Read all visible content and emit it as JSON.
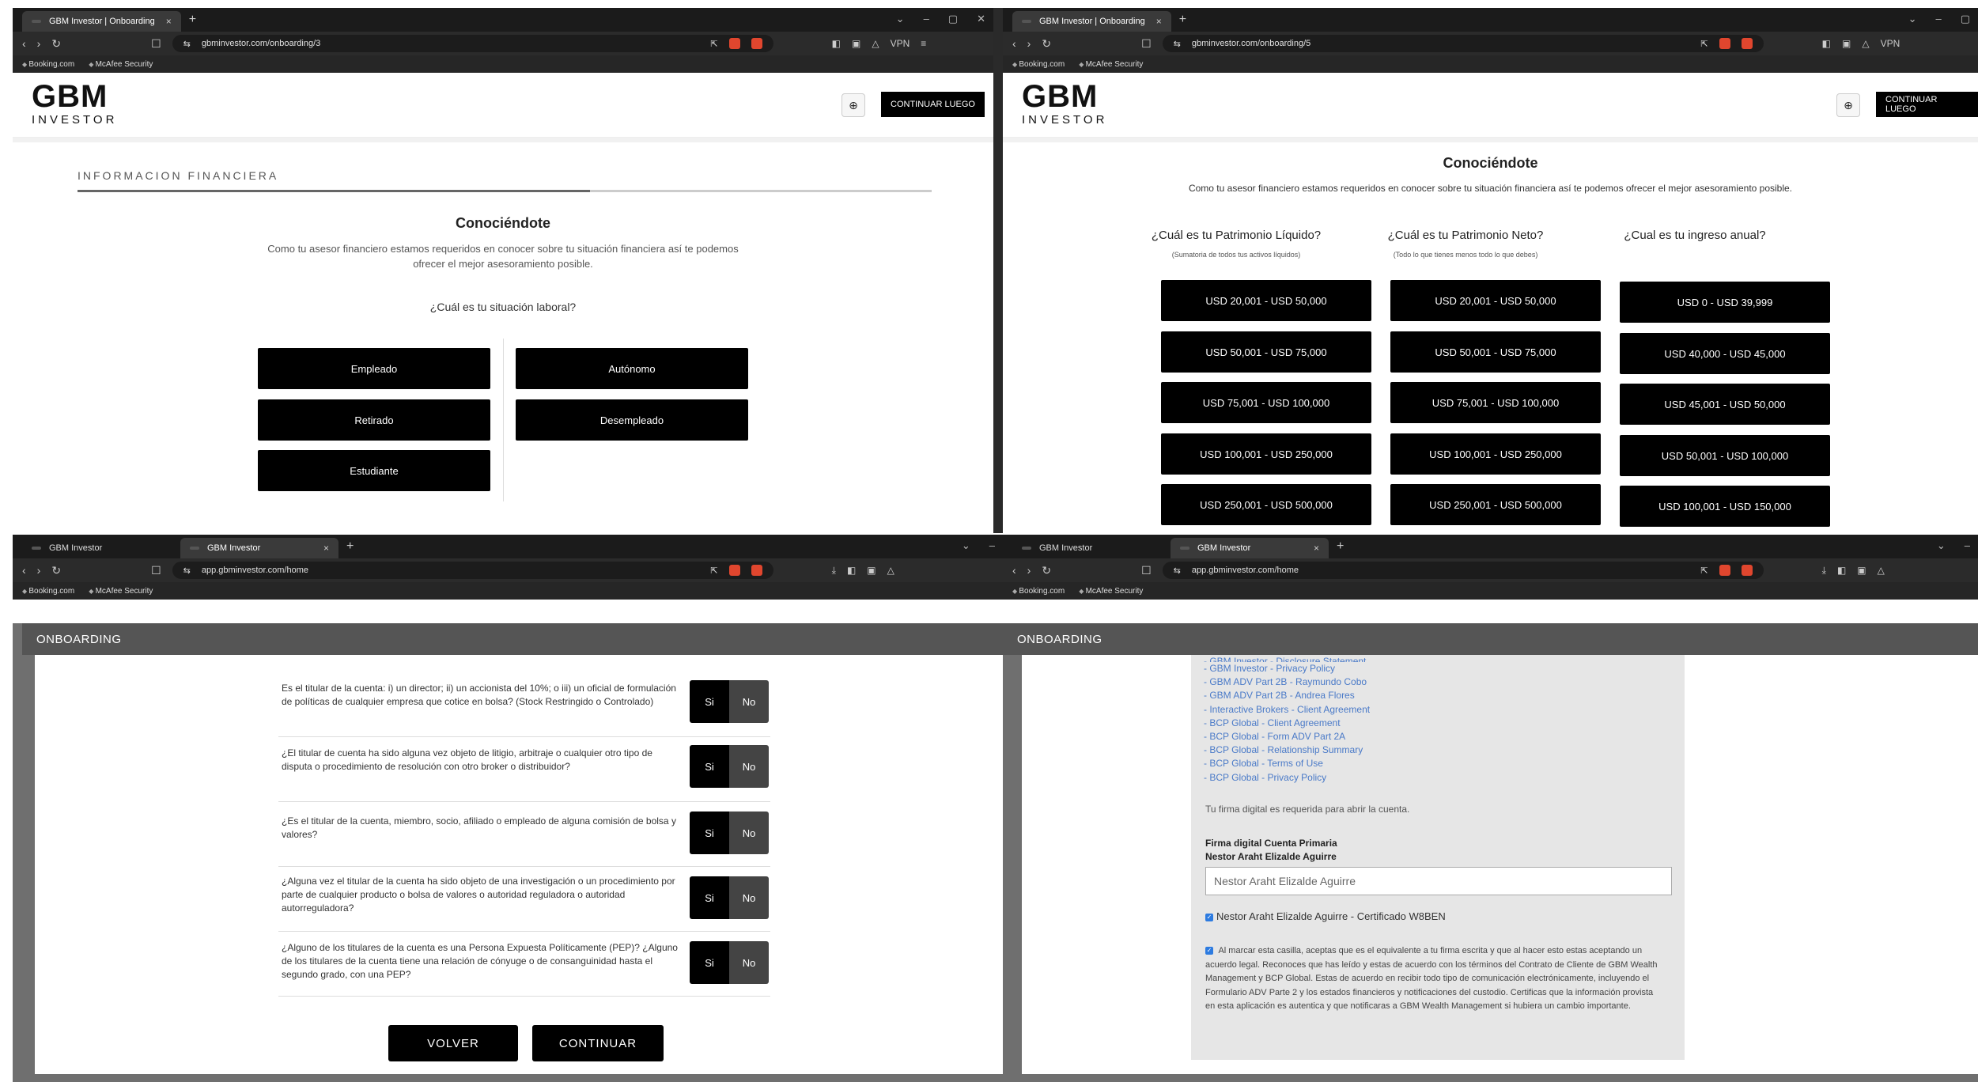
{
  "browser": {
    "win_controls": [
      "⌄",
      "–",
      "▢",
      "✕"
    ],
    "bookmarks": [
      "Booking.com",
      "McAfee Security"
    ],
    "vpn_label": "VPN",
    "tab_close": "×",
    "new_tab": "+"
  },
  "q1": {
    "tab_title": "GBM Investor | Onboarding",
    "url": "gbminvestor.com/onboarding/3",
    "logo_main": "GBM",
    "logo_sub": "INVESTOR",
    "continue_later": "CONTINUAR LUEGO",
    "section_title": "INFORMACION FINANCIERA",
    "heading": "Conociéndote",
    "description": "Como tu asesor financiero estamos requeridos en conocer sobre tu situación financiera así te podemos ofrecer el mejor asesoramiento posible.",
    "question": "¿Cuál es tu situación laboral?",
    "options": [
      "Empleado",
      "Autónomo",
      "Retirado",
      "Desempleado",
      "Estudiante"
    ],
    "progress_fraction": 0.6
  },
  "q2": {
    "tab_title": "GBM Investor | Onboarding",
    "url": "gbminvestor.com/onboarding/5",
    "logo_main": "GBM",
    "logo_sub": "INVESTOR",
    "continue_later": "CONTINUAR LUEGO",
    "heading": "Conociéndote",
    "description": "Como tu asesor financiero estamos requeridos en conocer sobre tu situación financiera así te podemos ofrecer el mejor asesoramiento posible.",
    "columns": [
      {
        "title": "¿Cuál es tu Patrimonio Líquido?",
        "subtitle": "(Sumatoria de todos tus activos líquidos)",
        "options": [
          "USD 20,001 - USD 50,000",
          "USD 50,001 - USD 75,000",
          "USD 75,001 - USD 100,000",
          "USD 100,001 - USD 250,000",
          "USD 250,001 - USD 500,000"
        ]
      },
      {
        "title": "¿Cuál es tu Patrimonio Neto?",
        "subtitle": "(Todo lo que tienes menos todo lo que debes)",
        "options": [
          "USD 20,001 - USD 50,000",
          "USD 50,001 - USD 75,000",
          "USD 75,001 - USD 100,000",
          "USD 100,001 - USD 250,000",
          "USD 250,001 - USD 500,000"
        ]
      },
      {
        "title": "¿Cual es tu ingreso anual?",
        "subtitle": "",
        "options": [
          "USD 0 - USD 39,999",
          "USD 40,000 - USD 45,000",
          "USD 45,001 - USD 50,000",
          "USD 50,001 - USD 100,000",
          "USD 100,001 - USD 150,000"
        ]
      }
    ]
  },
  "q3": {
    "tabs": [
      "GBM Investor",
      "GBM Investor"
    ],
    "url": "app.gbminvestor.com/home",
    "modal_title": "ONBOARDING",
    "yes": "Si",
    "no": "No",
    "questions": [
      "Es el titular de la cuenta: i) un director; ii) un accionista del 10%; o iii) un oficial de formulación de políticas de cualquier empresa que cotice en bolsa? (Stock Restringido o Controlado)",
      "¿El titular de cuenta ha sido alguna vez objeto de litigio, arbitraje o cualquier otro tipo de disputa o procedimiento de resolución con otro broker o distribuidor?",
      "¿Es el titular de la cuenta, miembro, socio, afiliado o empleado de alguna comisión de bolsa y valores?",
      "¿Alguna vez el titular de la cuenta ha sido objeto de una investigación o un procedimiento por parte de cualquier producto o bolsa de valores o autoridad reguladora o autoridad autorreguladora?",
      "¿Alguno de los titulares de la cuenta es una Persona Expuesta Políticamente (PEP)? ¿Alguno de los titulares de la cuenta tiene una relación de cónyuge o de consanguinidad hasta el segundo grado, con una PEP?"
    ],
    "back": "VOLVER",
    "continue": "CONTINUAR"
  },
  "q4": {
    "tabs": [
      "GBM Investor",
      "GBM Investor"
    ],
    "url": "app.gbminvestor.com/home",
    "modal_title": "ONBOARDING",
    "links": [
      "- GBM Investor - Disclosure Statement",
      "- GBM Investor - Privacy Policy",
      "- GBM ADV Part 2B - Raymundo Cobo",
      "- GBM ADV Part 2B - Andrea Flores",
      "- Interactive Brokers - Client Agreement",
      "- BCP Global - Client Agreement",
      "- BCP Global - Form ADV Part 2A",
      "- BCP Global - Relationship Summary",
      "- BCP Global - Terms of Use",
      "- BCP Global - Privacy Policy"
    ],
    "signature_required": "Tu firma digital es requerida para abrir la cuenta.",
    "sig_label": "Firma digital Cuenta Primaria",
    "sig_name": "Nestor Araht Elizalde Aguirre",
    "sig_value": "Nestor Araht Elizalde Aguirre",
    "certificate": "Nestor Araht Elizalde Aguirre - Certificado W8BEN",
    "legal": "Al marcar esta casilla, aceptas que es el equivalente a tu firma escrita y que al hacer esto estas aceptando un acuerdo legal. Reconoces que has leído y estas de acuerdo con los términos del Contrato de Cliente de GBM Wealth Management y BCP Global. Estas de acuerdo en recibir todo tipo de comunicación electrónicamente, incluyendo el Formulario ADV Parte 2 y los estados financieros y notificaciones del custodio. Certificas que la información provista en esta aplicación es autentica y que notificaras a GBM Wealth Management si hubiera un cambio importante."
  }
}
